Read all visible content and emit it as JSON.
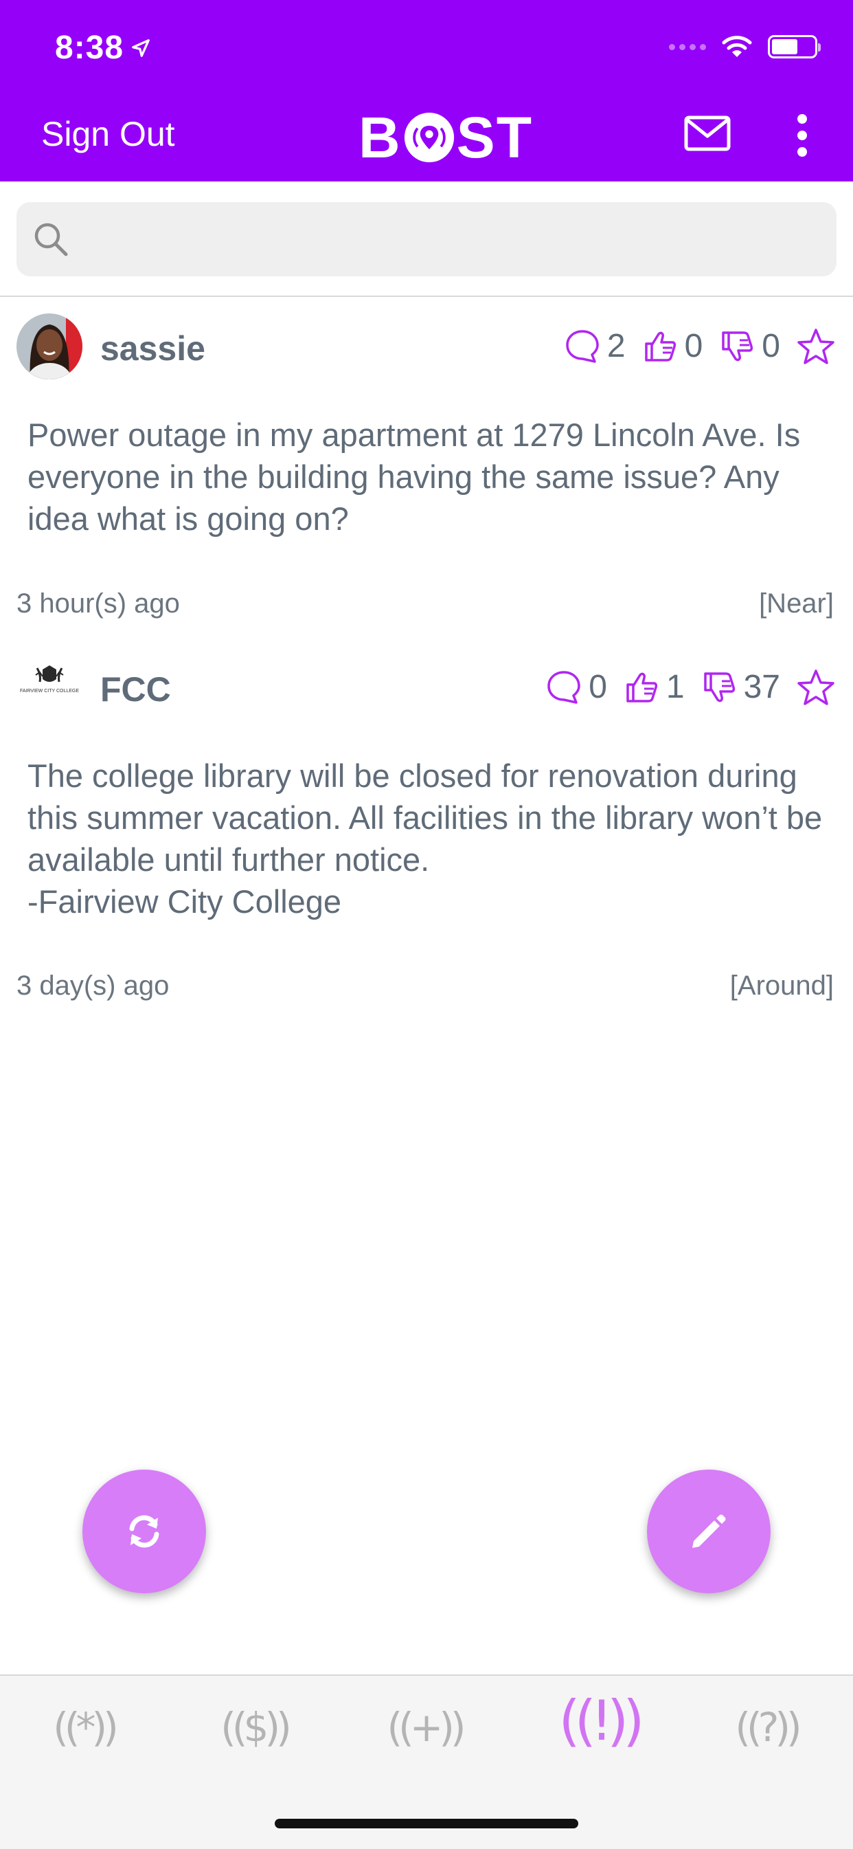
{
  "status_bar": {
    "time": "8:38"
  },
  "header": {
    "sign_out": "Sign Out",
    "logo_text_left": "B",
    "logo_text_right": "ST",
    "brand_color": "#9500f9"
  },
  "search": {
    "placeholder": ""
  },
  "posts": [
    {
      "username": "sassie",
      "comments": "2",
      "likes": "0",
      "dislikes": "0",
      "text": "Power outage in my apartment at 1279 Lincoln Ave. Is everyone in the building having the same issue? Any idea what is going on?",
      "time": "3 hour(s) ago",
      "scope": "[Near]"
    },
    {
      "username": "FCC",
      "comments": "0",
      "likes": "1",
      "dislikes": "37",
      "text": "The college library will be closed for renovation during this summer vacation. All facilities in the library won’t be available until further notice.\n-Fairview City College",
      "time": "3 day(s) ago",
      "scope": "[Around]",
      "avatar_caption": "FAIRVIEW CITY COLLEGE"
    }
  ],
  "tabs": [
    {
      "label": "((*))",
      "active": false
    },
    {
      "label": "(($))",
      "active": false
    },
    {
      "label": "((+))",
      "active": false
    },
    {
      "label": "((!))",
      "active": true
    },
    {
      "label": "((?))",
      "active": false
    }
  ],
  "colors": {
    "accent": "#9500f9",
    "fab": "#d77df8",
    "icon": "#b026f0",
    "text": "#5f6b78"
  }
}
